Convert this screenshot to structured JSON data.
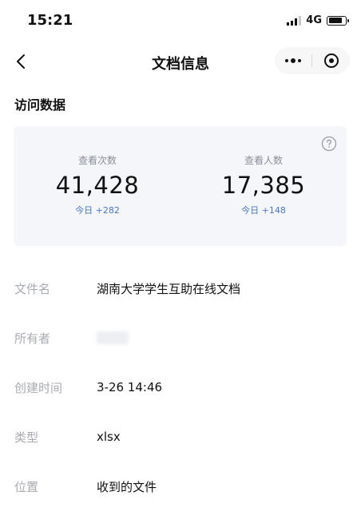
{
  "status_bar": {
    "time": "15:21",
    "network": "4G",
    "battery_level": 0.85
  },
  "nav": {
    "title": "文档信息"
  },
  "stats": {
    "section_title": "访问数据",
    "views": {
      "label": "查看次数",
      "value": "41,428",
      "today": "今日 +282"
    },
    "visitors": {
      "label": "查看人数",
      "value": "17,385",
      "today": "今日 +148"
    }
  },
  "info": {
    "filename": {
      "label": "文件名",
      "value": "湖南大学学生互助在线文档"
    },
    "owner": {
      "label": "所有者",
      "value": ""
    },
    "created": {
      "label": "创建时间",
      "value": "3-26 14:46"
    },
    "type": {
      "label": "类型",
      "value": "xlsx"
    },
    "location": {
      "label": "位置",
      "value": "收到的文件"
    }
  },
  "colors": {
    "card_bg": "#f4f6f9",
    "accent_blue": "#4a78c9",
    "label_gray": "#a8abb2"
  }
}
